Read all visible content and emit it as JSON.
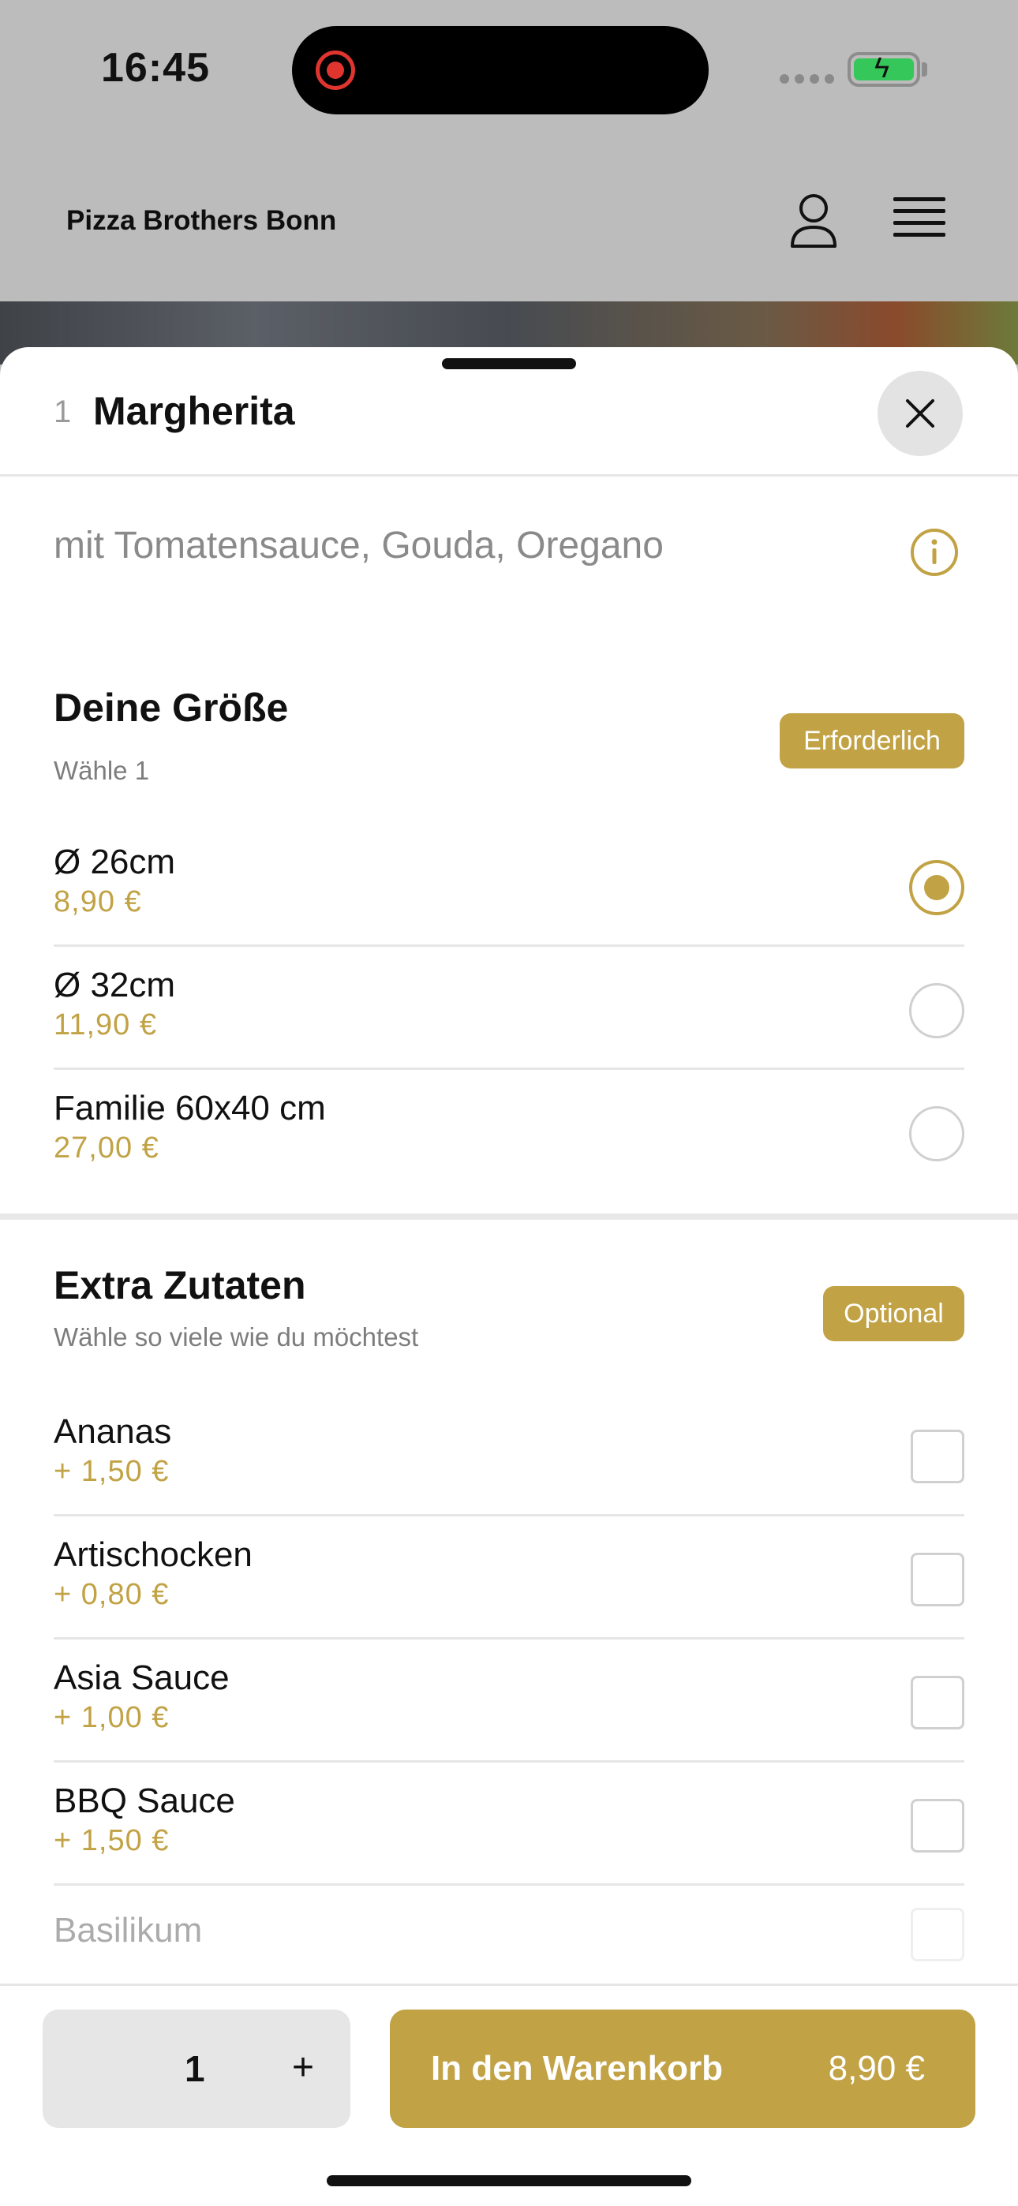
{
  "status_bar": {
    "time": "16:45"
  },
  "header": {
    "brand": "Pizza Brothers Bonn"
  },
  "item": {
    "number": "1",
    "title": "Margherita",
    "description": "mit Tomatensauce, Gouda, Oregano"
  },
  "size_section": {
    "title": "Deine Größe",
    "subtitle": "Wähle 1",
    "badge": "Erforderlich",
    "options": [
      {
        "name": "Ø 26cm",
        "price": "8,90 €",
        "selected": true
      },
      {
        "name": "Ø 32cm",
        "price": "11,90 €",
        "selected": false
      },
      {
        "name": "Familie 60x40 cm",
        "price": "27,00 €",
        "selected": false
      }
    ]
  },
  "extras_section": {
    "title": "Extra Zutaten",
    "subtitle": "Wähle so viele wie du möchtest",
    "badge": "Optional",
    "options": [
      {
        "name": "Ananas",
        "price": "+ 1,50 €"
      },
      {
        "name": "Artischocken",
        "price": "+ 0,80 €"
      },
      {
        "name": "Asia Sauce",
        "price": "+ 1,00 €"
      },
      {
        "name": "BBQ Sauce",
        "price": "+ 1,50 €"
      },
      {
        "name": "Basilikum",
        "price": ""
      }
    ]
  },
  "footer": {
    "quantity": "1",
    "plus_label": "+",
    "cart_label": "In den Warenkorb",
    "cart_price": "8,90 €"
  },
  "colors": {
    "accent": "#c1a244",
    "battery": "#35c759",
    "record": "#e0352f"
  }
}
